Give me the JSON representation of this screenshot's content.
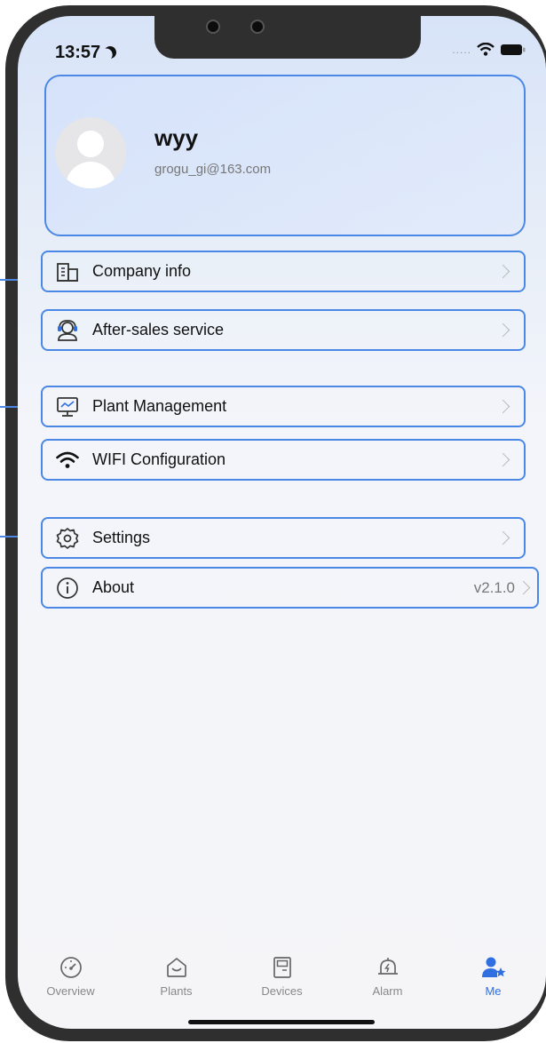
{
  "status_bar": {
    "time": "13:57",
    "icons": [
      "moon-icon",
      "signal-dots-icon",
      "wifi-icon",
      "battery-icon"
    ]
  },
  "profile": {
    "name": "wyy",
    "email": "grogu_gi@163.com",
    "avatar_icon": "user-avatar-icon"
  },
  "menu": {
    "items": [
      {
        "label": "Company info",
        "icon": "building-icon"
      },
      {
        "label": "After-sales service",
        "icon": "support-agent-icon"
      },
      {
        "label": "Plant Management",
        "icon": "monitor-icon"
      },
      {
        "label": "WIFI Configuration",
        "icon": "wifi-icon"
      },
      {
        "label": "Settings",
        "icon": "gear-icon"
      },
      {
        "label": "About",
        "icon": "info-icon",
        "value": "v2.1.0"
      }
    ]
  },
  "tabbar": {
    "tabs": [
      {
        "label": "Overview",
        "icon": "gauge-icon",
        "active": false
      },
      {
        "label": "Plants",
        "icon": "plant-home-icon",
        "active": false
      },
      {
        "label": "Devices",
        "icon": "device-icon",
        "active": false
      },
      {
        "label": "Alarm",
        "icon": "alarm-bell-icon",
        "active": false
      },
      {
        "label": "Me",
        "icon": "user-star-icon",
        "active": true
      }
    ]
  },
  "colors": {
    "accent": "#2f6fe0",
    "highlight_border": "#4b88e6",
    "text_primary": "#111111",
    "text_secondary": "#777777",
    "tab_inactive": "#888888"
  }
}
